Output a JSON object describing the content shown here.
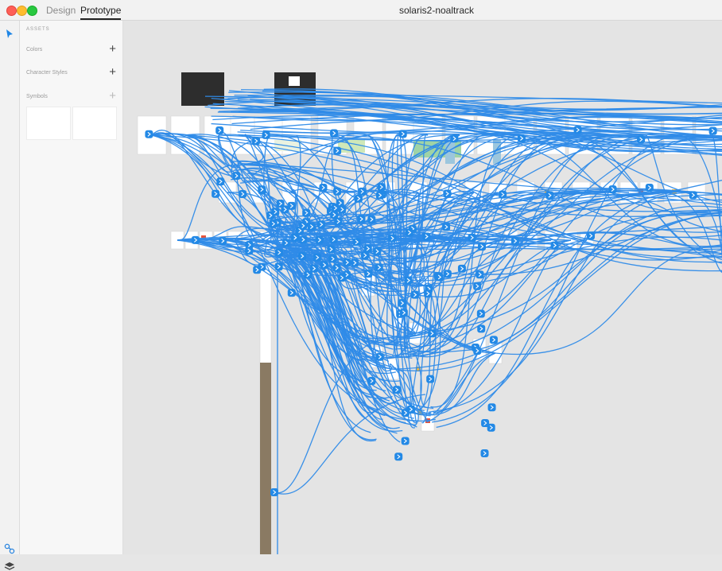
{
  "window": {
    "title": "solaris2-noaltrack",
    "tabs": [
      {
        "label": "Design",
        "active": false
      },
      {
        "label": "Prototype",
        "active": true
      }
    ]
  },
  "toolbar": {
    "tools": [
      "select-tool-icon",
      "link-tool-icon",
      "layers-icon"
    ]
  },
  "assets": {
    "heading": "ASSETS",
    "colors_label": "Colors",
    "character_styles_label": "Character Styles",
    "symbols_label": "Symbols",
    "plus_glyph": "+"
  },
  "colors": {
    "accent": "#2f8be8",
    "canvas": "#e4e4e4",
    "panel": "#f7f7f7"
  },
  "canvas": {
    "description_free": true,
    "handle_color": "#2389e6",
    "wire_color": "#2f8be8"
  }
}
